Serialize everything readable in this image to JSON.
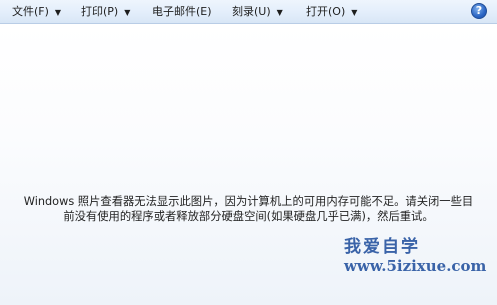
{
  "menubar": {
    "items": [
      {
        "label": "文件(F)"
      },
      {
        "label": "打印(P)"
      },
      {
        "label": "电子邮件(E)"
      },
      {
        "label": "刻录(U)"
      },
      {
        "label": "打开(O)"
      }
    ],
    "help_label": "?"
  },
  "message": {
    "line1": "Windows 照片查看器无法显示此图片，因为计算机上的可用内存可能不足。请关闭一些目",
    "line2": "前没有使用的程序或者释放部分硬盘空间(如果硬盘几乎已满)，然后重试。"
  },
  "watermark": {
    "title": "我爱自学",
    "url": "www.5izixue.com"
  },
  "colors": {
    "menubar_background": "#e3eefb",
    "text": "#222222",
    "watermark": "#3a63a8"
  }
}
